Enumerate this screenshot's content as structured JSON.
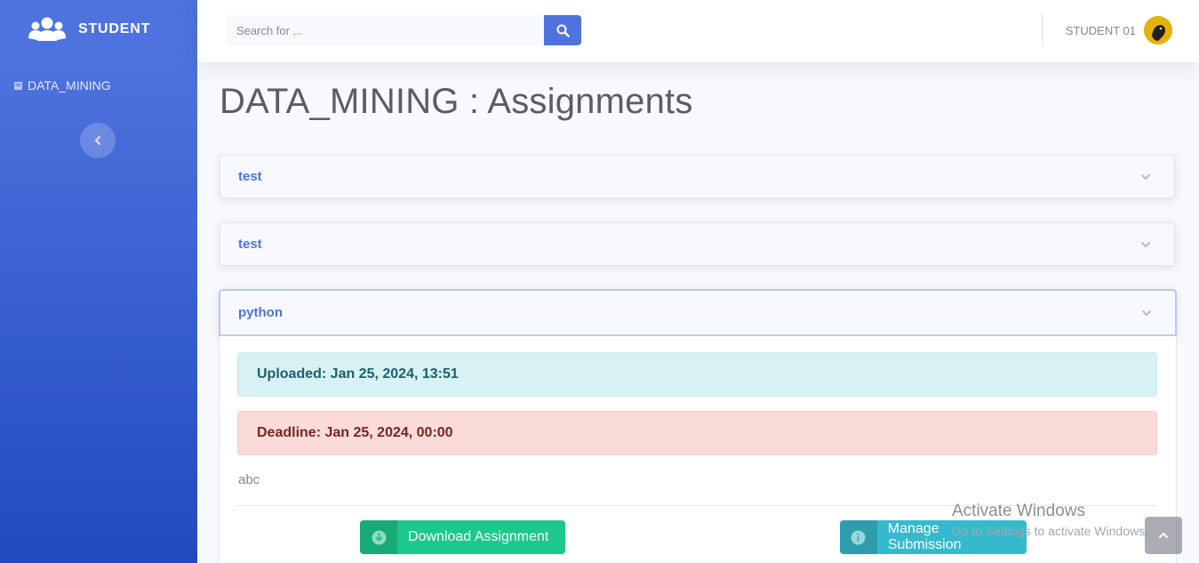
{
  "sidebar": {
    "brand": "STUDENT",
    "items": [
      {
        "label": "DATA_MINING",
        "icon": "book-icon"
      }
    ],
    "toggle_icon": "chevron-left-icon"
  },
  "topbar": {
    "search": {
      "placeholder": "Search for ...",
      "value": "",
      "icon": "search-icon"
    },
    "user_name": "STUDENT 01"
  },
  "main": {
    "title": "DATA_MINING : Assignments",
    "assignments": [
      {
        "title": "test",
        "expanded": false
      },
      {
        "title": "test",
        "expanded": false
      },
      {
        "title": "python",
        "expanded": true,
        "uploaded": "Uploaded: Jan 25, 2024, 13:51",
        "deadline": "Deadline: Jan 25, 2024, 00:00",
        "description": "abc",
        "download_label": "Download Assignment",
        "manage_label": "Manage Submission"
      }
    ]
  },
  "overlay": {
    "watermark_title": "Activate Windows",
    "watermark_sub": "Go to Settings to activate Windows."
  },
  "colors": {
    "primary": "#4e73df",
    "success": "#1cc88a",
    "info": "#36b9cc"
  }
}
